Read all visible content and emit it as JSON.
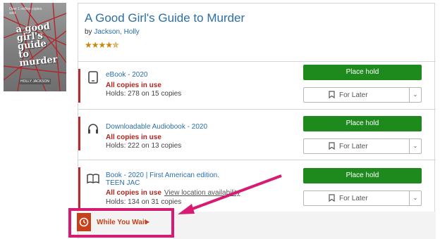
{
  "book": {
    "title": "A Good Girl's Guide to Murder",
    "by_label": "by",
    "author": "Jackson, Holly",
    "rating_stars": "★★★★✯",
    "rating_value": 4.5,
    "cover": {
      "top_text": "Over 1 million copies sold",
      "title_text": "a good girl's guide to murder",
      "author_text": "HOLLY JACKSON"
    }
  },
  "formats": [
    {
      "icon": "tablet-icon",
      "title": "eBook - 2020",
      "status": "All copies in use",
      "link": "",
      "holds": "Holds: 278 on 15 copies",
      "hold_label": "Place hold",
      "later_label": "For Later"
    },
    {
      "icon": "headphones-icon",
      "title": "Downloadable Audiobook - 2020",
      "status": "All copies in use",
      "link": "",
      "holds": "Holds: 222 on 13 copies",
      "hold_label": "Place hold",
      "later_label": "For Later"
    },
    {
      "icon": "open-book-icon",
      "title": "Book - 2020 | First American edition.",
      "title2": "TEEN JAC",
      "status": "All copies in use",
      "link": "View location availability",
      "holds": "Holds: 134 on 31 copies",
      "hold_label": "Place hold",
      "later_label": "For Later"
    }
  ],
  "while_you_wait": {
    "label": "While You Wait",
    "caret": "▶"
  },
  "colors": {
    "link": "#2a6fa8",
    "status": "#b0261f",
    "hold_button": "#1e8a1e",
    "annotation": "#d81b72",
    "wait_accent": "#c8401a"
  }
}
